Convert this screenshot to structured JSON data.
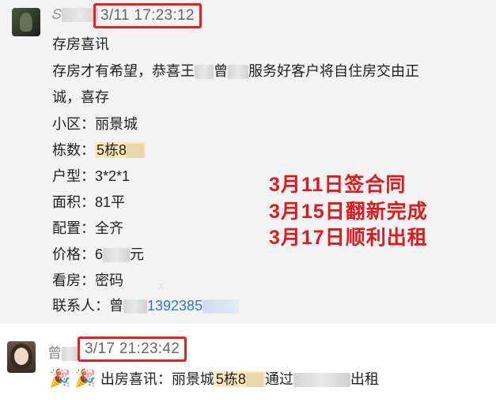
{
  "message1": {
    "sender": "𝑆",
    "time": "3/11 17:23:12",
    "lines": {
      "title": "存房喜讯",
      "body_line1_a": "存房才有希望，恭喜王",
      "body_line1_b": "曾",
      "body_line1_c": "服务好客户将自住房交由正",
      "body_line2": "诚，喜存",
      "community_label": "小区：",
      "community_value": "丽景城",
      "building_label": "栋数：",
      "building_value": "5栋8",
      "layout_label": "户型：",
      "layout_value": "3*2*1",
      "area_label": "面积：",
      "area_value": "81平",
      "config_label": "配置：",
      "config_value": "全齐",
      "price_label": "价格：",
      "price_value_a": "6",
      "price_value_b": "元",
      "viewing_label": "看房：",
      "viewing_value": "密码",
      "contact_label": "联系人：",
      "contact_name": "曾",
      "contact_phone": "1392385"
    },
    "annotation": {
      "line1": "3月11日签合同",
      "line2": "3月15日翻新完成",
      "line3": "3月17日顺利出租"
    },
    "faint_mark": "ㅈ"
  },
  "message2": {
    "sender": "曾",
    "time": "3/17 21:23:42",
    "emoji": "🎉",
    "text_a": "出房喜讯：丽景城",
    "text_hl": "5栋8",
    "text_b": "通过",
    "text_c": "出租"
  },
  "colors": {
    "highlight_box": "#e8201f",
    "annotation_red": "#e0191c",
    "link_blue": "#2f74d0",
    "text_highlight": "#fde7b8"
  }
}
